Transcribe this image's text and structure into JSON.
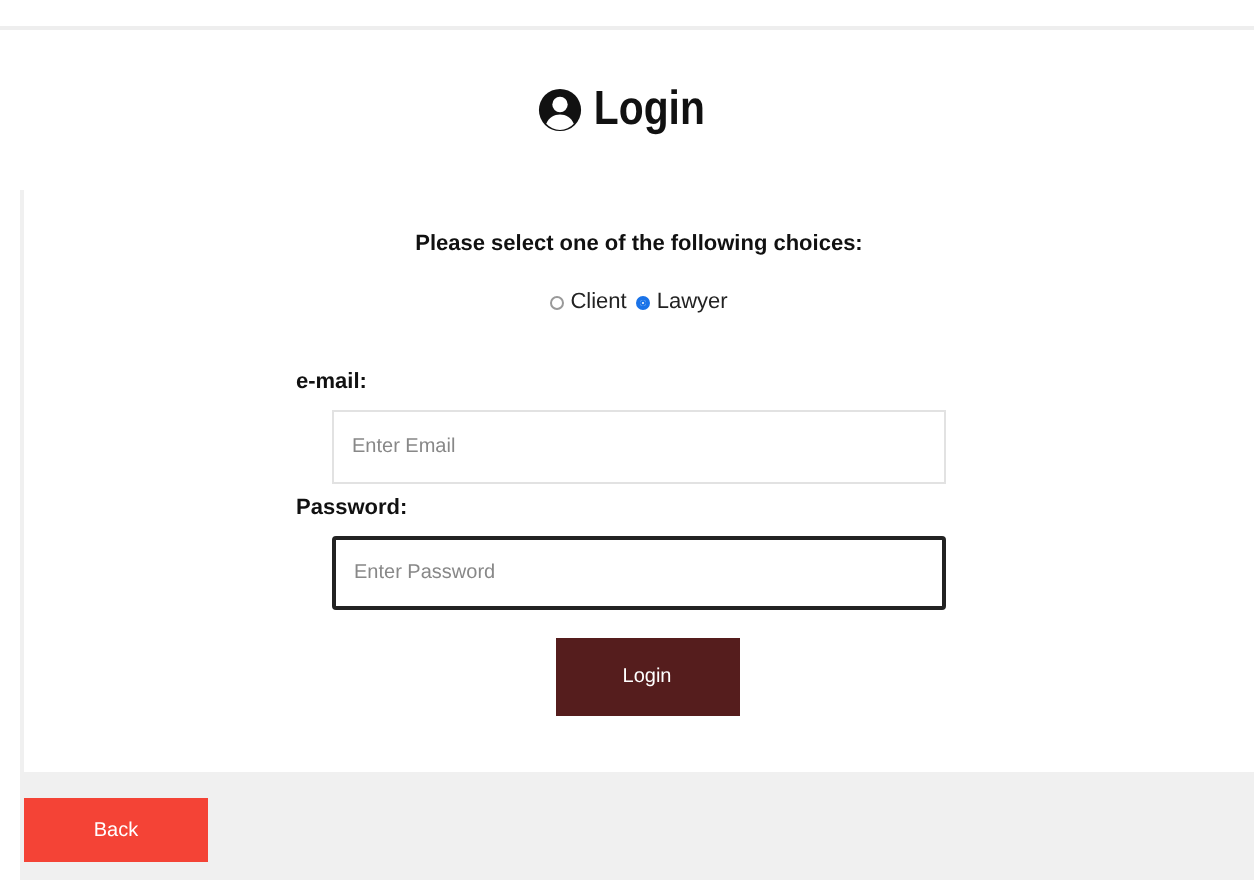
{
  "title": "Login",
  "prompt": "Please select one of the following choices:",
  "roles": [
    {
      "label": "Client",
      "selected": false
    },
    {
      "label": "Lawyer",
      "selected": true
    }
  ],
  "fields": [
    {
      "label": "e-mail:",
      "placeholder": "Enter Email",
      "focused": false
    },
    {
      "label": "Password:",
      "placeholder": "Enter Password",
      "focused": true
    }
  ],
  "submit": "Login",
  "back": "Back"
}
